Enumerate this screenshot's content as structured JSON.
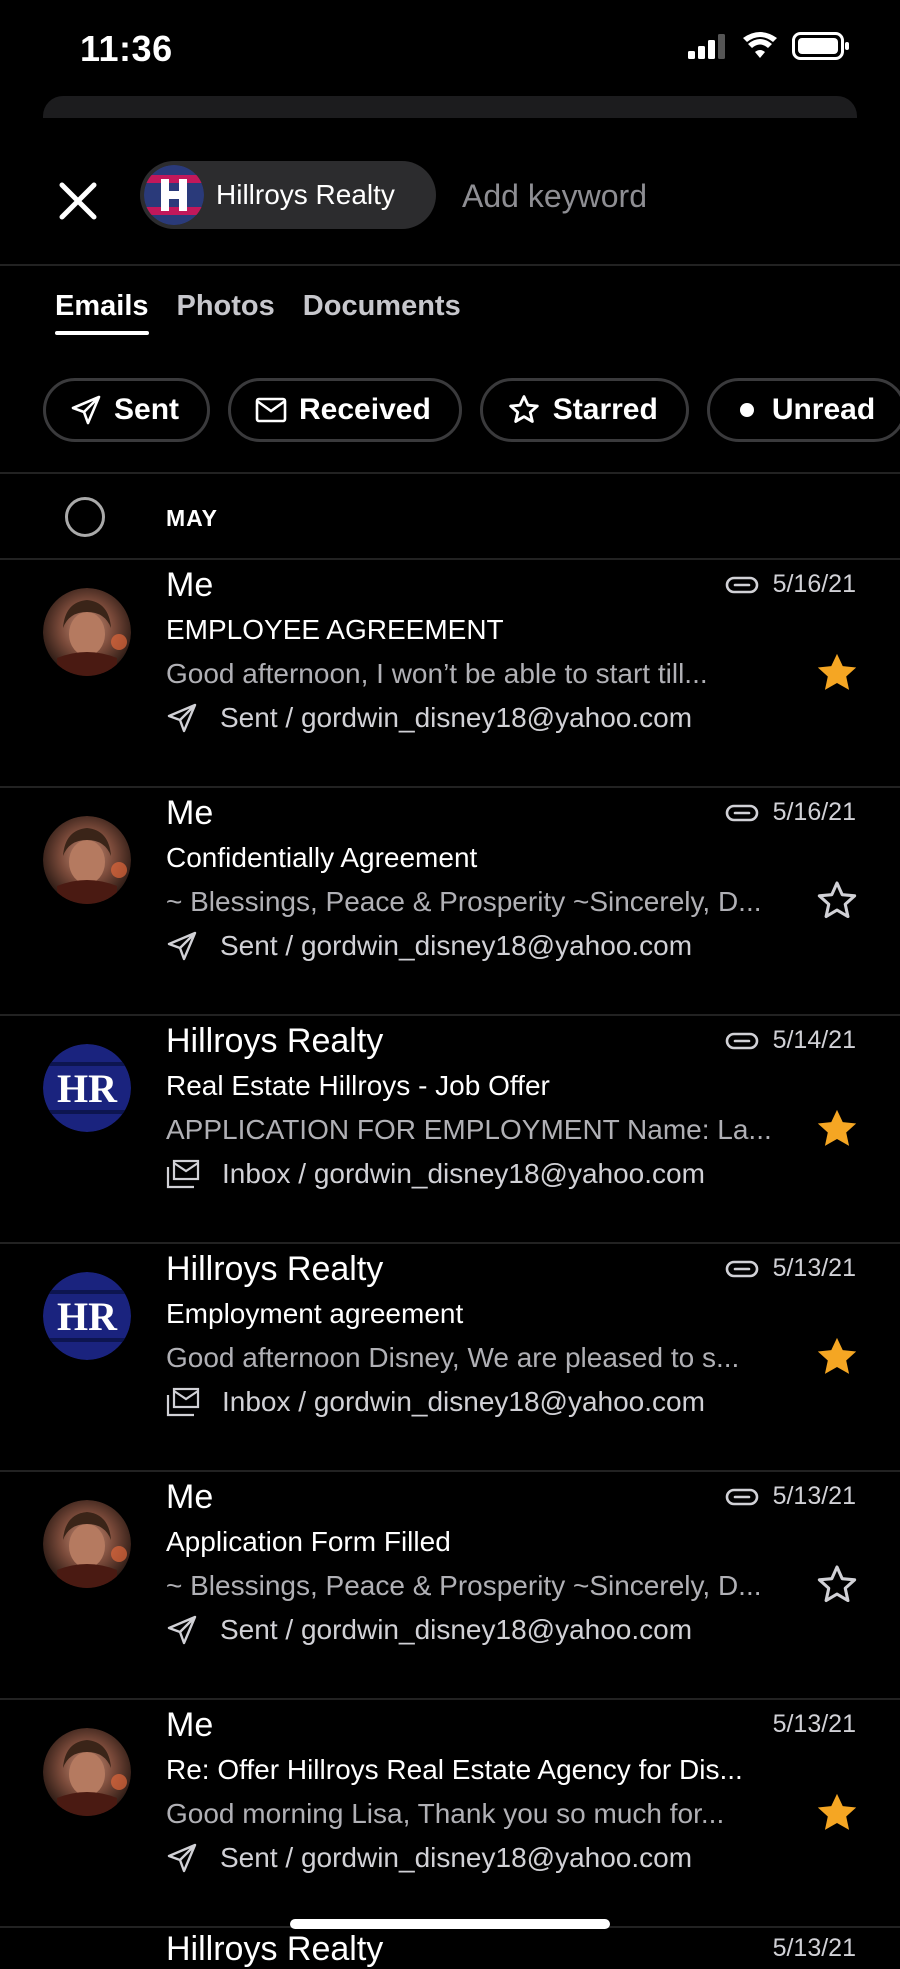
{
  "status": {
    "time": "11:36"
  },
  "search": {
    "chip_label": "Hillroys Realty",
    "keyword_placeholder": "Add keyword"
  },
  "tabs": [
    {
      "label": "Emails",
      "active": true
    },
    {
      "label": "Photos",
      "active": false
    },
    {
      "label": "Documents",
      "active": false
    }
  ],
  "filters": [
    {
      "label": "Sent",
      "icon": "send-icon"
    },
    {
      "label": "Received",
      "icon": "envelope-icon"
    },
    {
      "label": "Starred",
      "icon": "star-outline-icon"
    },
    {
      "label": "Unread",
      "icon": "dot-icon"
    }
  ],
  "section": {
    "label": "MAY"
  },
  "emails": [
    {
      "sender": "Me",
      "date": "5/16/21",
      "attachment": true,
      "subject": "EMPLOYEE AGREEMENT",
      "preview": "Good afternoon, I won’t be able to start till...",
      "folder_icon": "send-icon",
      "folder": "Sent / gordwin_disney18@yahoo.com",
      "starred": true,
      "avatar": "photo"
    },
    {
      "sender": "Me",
      "date": "5/16/21",
      "attachment": true,
      "subject": "Confidentially Agreement",
      "preview": "~ Blessings, Peace & Prosperity ~Sincerely, D...",
      "folder_icon": "send-icon",
      "folder": "Sent / gordwin_disney18@yahoo.com",
      "starred": false,
      "avatar": "photo"
    },
    {
      "sender": "Hillroys Realty",
      "date": "5/14/21",
      "attachment": true,
      "subject": "Real Estate Hillroys - Job Offer",
      "preview": "APPLICATION FOR EMPLOYMENT Name: La...",
      "folder_icon": "inbox-icon",
      "folder": "Inbox / gordwin_disney18@yahoo.com",
      "starred": true,
      "avatar": "HR"
    },
    {
      "sender": "Hillroys Realty",
      "date": "5/13/21",
      "attachment": true,
      "subject": "Employment agreement",
      "preview": "Good afternoon Disney, We are pleased to s...",
      "folder_icon": "inbox-icon",
      "folder": "Inbox / gordwin_disney18@yahoo.com",
      "starred": true,
      "avatar": "HR"
    },
    {
      "sender": "Me",
      "date": "5/13/21",
      "attachment": true,
      "subject": "Application Form Filled",
      "preview": "~ Blessings, Peace & Prosperity ~Sincerely, D...",
      "folder_icon": "send-icon",
      "folder": "Sent / gordwin_disney18@yahoo.com",
      "starred": false,
      "avatar": "photo"
    },
    {
      "sender": "Me",
      "date": "5/13/21",
      "attachment": false,
      "subject": "Re: Offer Hillroys Real Estate Agency for Dis...",
      "preview": "Good morning Lisa, Thank you so much for...",
      "folder_icon": "send-icon",
      "folder": "Sent / gordwin_disney18@yahoo.com",
      "starred": true,
      "avatar": "photo"
    }
  ],
  "peek_row": {
    "sender": "Hillroys Realty",
    "date": "5/13/21"
  },
  "colors": {
    "star": "#f5a623",
    "background": "#000000",
    "hr_avatar": "#1a237e"
  }
}
